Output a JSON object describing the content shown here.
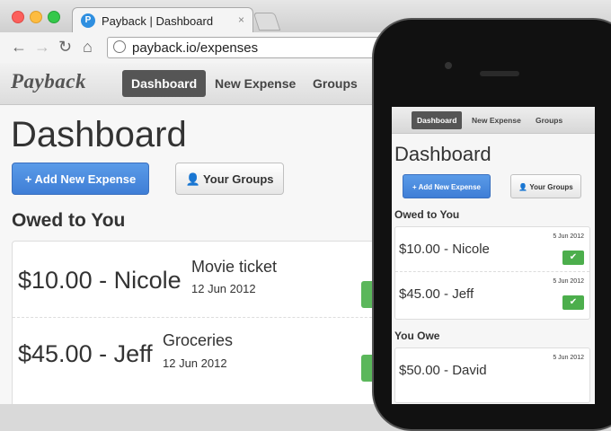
{
  "browser": {
    "tab_title": "Payback | Dashboard",
    "favicon_letter": "P",
    "tab_close": "×",
    "url": "payback.io/expenses"
  },
  "navbar": {
    "brand": "Payback",
    "items": [
      "Dashboard",
      "New Expense",
      "Groups"
    ],
    "active": "Dashboard"
  },
  "page": {
    "title": "Dashboard",
    "add_button": "+ Add New Expense",
    "groups_button": "Your Groups",
    "owed_heading": "Owed to You",
    "expenses": [
      {
        "amount": "$10.00 - Nicole",
        "description": "Movie ticket",
        "date": "12 Jun 2012"
      },
      {
        "amount": "$45.00 - Jeff",
        "description": "Groceries",
        "date": "12 Jun 2012"
      }
    ]
  },
  "mobile": {
    "nav_items": [
      "Dashboard",
      "New Expense",
      "Groups"
    ],
    "title": "Dashboard",
    "add_button": "+ Add New Expense",
    "groups_button": "Your Groups",
    "owed_heading": "Owed to You",
    "owed": [
      {
        "amount": "$10.00 - Nicole",
        "date": "5 Jun 2012"
      },
      {
        "amount": "$45.00 - Jeff",
        "date": "5 Jun 2012"
      }
    ],
    "owe_heading": "You Owe",
    "owe": [
      {
        "amount": "$50.00 - David",
        "date": "5 Jun 2012"
      }
    ]
  },
  "colors": {
    "primary": "#4a8be2",
    "success": "#5bb75b",
    "nav_active": "#555555"
  }
}
